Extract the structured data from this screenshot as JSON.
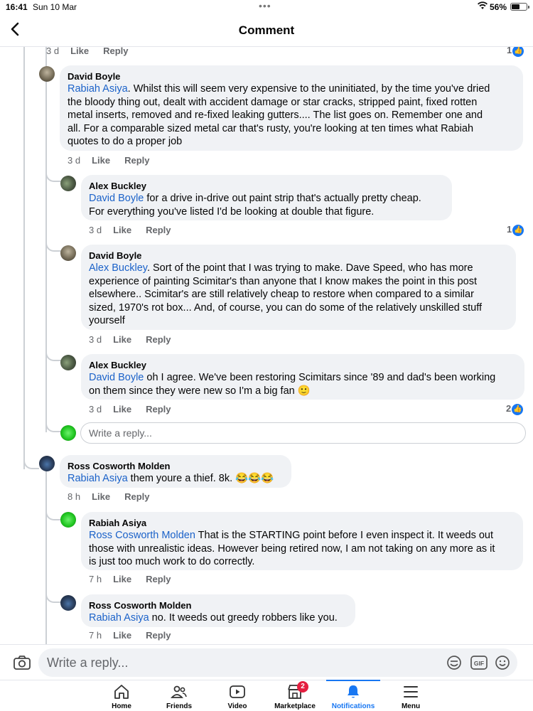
{
  "status_bar": {
    "time": "16:41",
    "date": "Sun 10 Mar",
    "battery": "56%"
  },
  "header": {
    "title": "Comment"
  },
  "labels": {
    "like": "Like",
    "reply": "Reply"
  },
  "top_row": {
    "age": "3 d",
    "reactions": "1"
  },
  "comments": [
    {
      "author": "David Boyle",
      "mention": "Rabiah Asiya",
      "lines": [
        ". Whilst this will seem very expensive to the uninitiated, by the time you've dried",
        "the bloody thing out, dealt with accident damage or star cracks, stripped paint, fixed rotten",
        "metal inserts, removed and re-fixed leaking gutters....  The list goes on.   Remember one and",
        "all. For a comparable sized metal car that's rusty, you're looking at ten times what  Rabiah",
        "quotes to do a proper job"
      ],
      "age": "3 d",
      "reactions": ""
    },
    {
      "author": "Alex Buckley",
      "mention": "David Boyle",
      "lines": [
        " for a drive in-drive out paint strip that's actually pretty cheap.",
        "For everything you've listed I'd be looking at double that figure."
      ],
      "age": "3 d",
      "reactions": "1"
    },
    {
      "author": "David Boyle",
      "mention": "Alex Buckley",
      "lines": [
        ".  Sort of the point that I was trying to make. Dave Speed, who has more",
        "experience of painting Scimitar's than anyone that I know makes the point in this post",
        "elsewhere..  Scimitar's are still relatively cheap to restore when compared to a similar",
        "sized, 1970's rot box...  And, of course, you can do some of the relatively unskilled stuff",
        "yourself"
      ],
      "age": "3 d",
      "reactions": ""
    },
    {
      "author": "Alex Buckley",
      "mention": "David Boyle",
      "lines": [
        " oh I agree.  We've been restoring Scimitars since '89 and dad's been working",
        "on them since they were new so I'm a big fan 🙂"
      ],
      "age": "3 d",
      "reactions": "2"
    },
    {
      "author": "Ross Cosworth Molden",
      "mention": "Rabiah Asiya",
      "lines": [
        " them youre a thief. 8k. 😂😂😂"
      ],
      "age": "8 h",
      "reactions": ""
    },
    {
      "author": "Rabiah Asiya",
      "mention": "Ross Cosworth Molden",
      "lines": [
        " That is the STARTING point before I even inspect it. It weeds out",
        "those with unrealistic ideas. However being retired now, I am not taking on any more as it",
        "is just too much work to do correctly."
      ],
      "age": "7 h",
      "reactions": ""
    },
    {
      "author": "Ross Cosworth Molden",
      "mention": "Rabiah Asiya",
      "lines": [
        " no. It weeds out greedy robbers like you."
      ],
      "age": "7 h",
      "reactions": ""
    }
  ],
  "inline_reply": {
    "placeholder": "Write a reply..."
  },
  "compose": {
    "placeholder": "Write a reply..."
  },
  "tabs": [
    {
      "label": "Home",
      "icon": "home-icon"
    },
    {
      "label": "Friends",
      "icon": "friends-icon"
    },
    {
      "label": "Video",
      "icon": "video-icon"
    },
    {
      "label": "Marketplace",
      "icon": "marketplace-icon",
      "badge": "2"
    },
    {
      "label": "Notifications",
      "icon": "bell-icon",
      "active": true
    },
    {
      "label": "Menu",
      "icon": "menu-icon"
    }
  ],
  "colors": {
    "accent": "#1877f2",
    "mention": "#1b62c9",
    "bubble": "#f0f2f5",
    "badge": "#e41e3f"
  }
}
